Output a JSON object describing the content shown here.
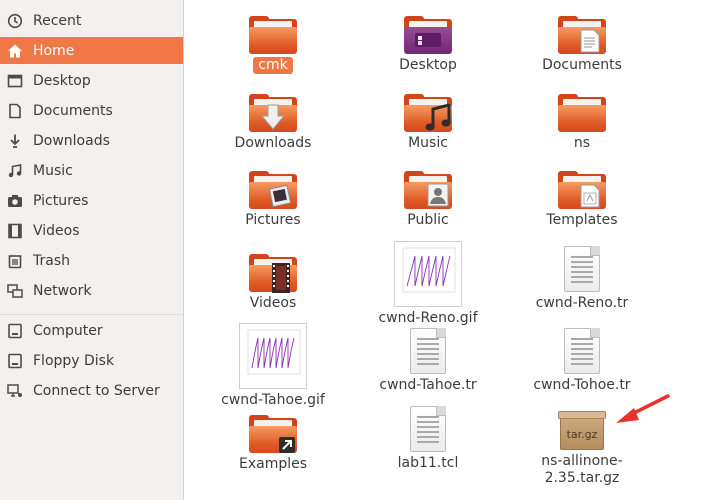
{
  "sidebar": {
    "items": [
      {
        "label": "Recent",
        "icon": "clock-icon"
      },
      {
        "label": "Home",
        "icon": "home-icon"
      },
      {
        "label": "Desktop",
        "icon": "desktop-icon"
      },
      {
        "label": "Documents",
        "icon": "document-icon"
      },
      {
        "label": "Downloads",
        "icon": "download-icon"
      },
      {
        "label": "Music",
        "icon": "music-icon"
      },
      {
        "label": "Pictures",
        "icon": "camera-icon"
      },
      {
        "label": "Videos",
        "icon": "video-icon"
      },
      {
        "label": "Trash",
        "icon": "trash-icon"
      },
      {
        "label": "Network",
        "icon": "network-icon"
      },
      {
        "label": "Computer",
        "icon": "computer-icon"
      },
      {
        "label": "Floppy Disk",
        "icon": "floppy-icon"
      },
      {
        "label": "Connect to Server",
        "icon": "server-icon"
      }
    ],
    "active": "Home"
  },
  "files": [
    {
      "name": "cmk",
      "type": "folder",
      "selected": true
    },
    {
      "name": "Desktop",
      "type": "folder-desktop"
    },
    {
      "name": "Documents",
      "type": "folder-documents"
    },
    {
      "name": "Downloads",
      "type": "folder-downloads"
    },
    {
      "name": "Music",
      "type": "folder-music"
    },
    {
      "name": "ns",
      "type": "folder"
    },
    {
      "name": "Pictures",
      "type": "folder-pictures"
    },
    {
      "name": "Public",
      "type": "folder-public"
    },
    {
      "name": "Templates",
      "type": "folder-templates"
    },
    {
      "name": "Videos",
      "type": "folder-videos"
    },
    {
      "name": "cwnd-Reno.gif",
      "type": "image"
    },
    {
      "name": "cwnd-Reno.tr",
      "type": "text"
    },
    {
      "name": "cwnd-Tahoe.gif",
      "type": "image"
    },
    {
      "name": "cwnd-Tahoe.tr",
      "type": "text"
    },
    {
      "name": "cwnd-Tohoe.tr",
      "type": "text"
    },
    {
      "name": "Examples",
      "type": "folder-link"
    },
    {
      "name": "lab11.tcl",
      "type": "text"
    },
    {
      "name": "ns-allinone-2.35.tar.gz",
      "type": "archive",
      "icon_text": "tar.gz"
    }
  ],
  "colors": {
    "accent": "#f07746",
    "folder": "#e05b27",
    "annotation_arrow": "#e8322a"
  }
}
